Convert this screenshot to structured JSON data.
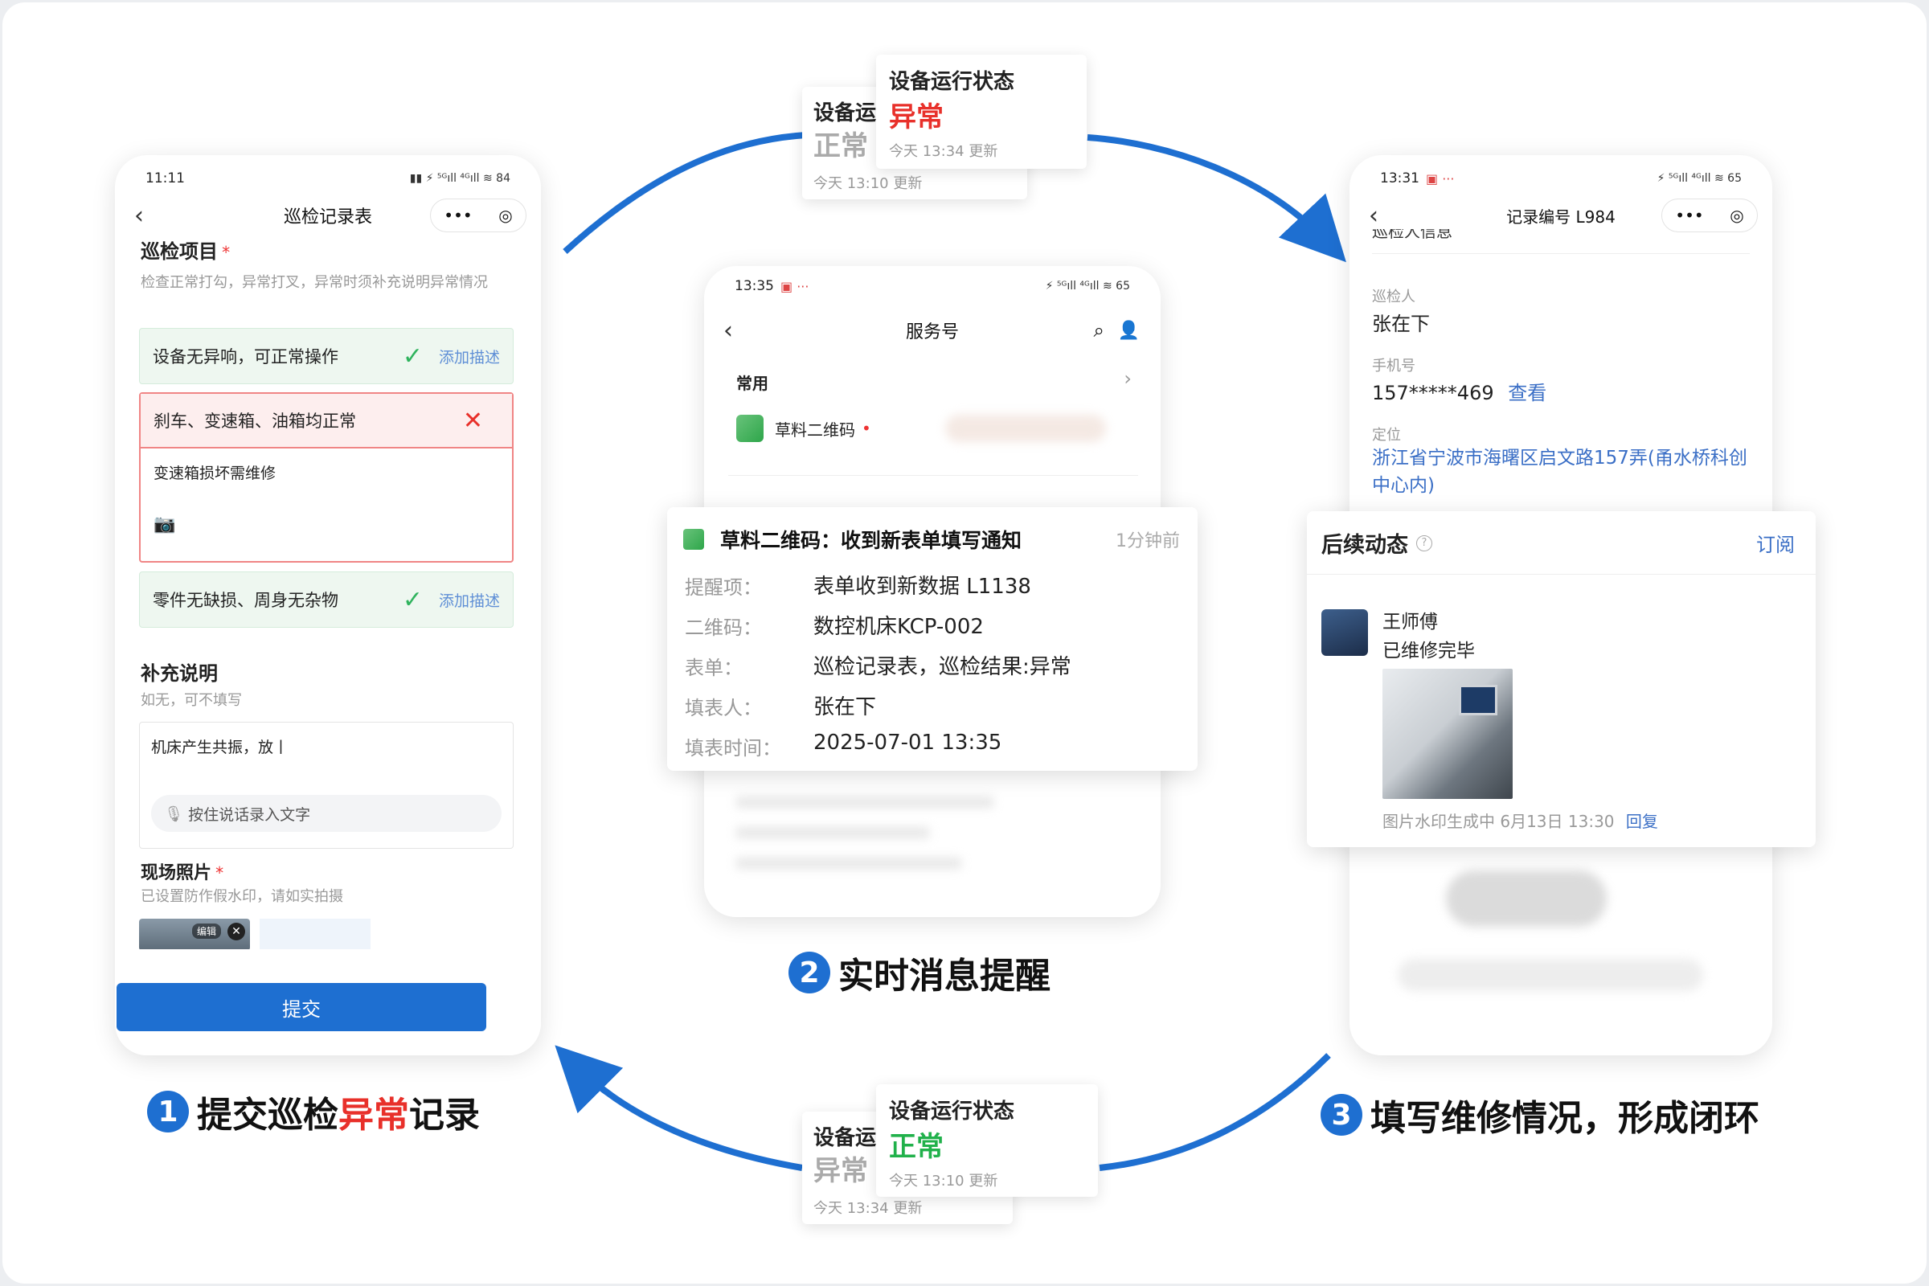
{
  "status_cards": {
    "top": {
      "back": {
        "title": "设备运",
        "value": "正常",
        "time": "今天 13:10 更新"
      },
      "front": {
        "title": "设备运行状态",
        "value": "异常",
        "time": "今天 13:34 更新"
      }
    },
    "bottom": {
      "back": {
        "title": "设备运",
        "value": "异常",
        "time": "今天 13:34 更新"
      },
      "front": {
        "title": "设备运行状态",
        "value": "正常",
        "time": "今天 13:10 更新"
      }
    }
  },
  "phone1": {
    "status_time": "11:11",
    "status_icons": "▮▮ ⚡ ⁵ᴳıll ⁴ᴳıll ≋ 84",
    "title": "巡检记录表",
    "section_title": "巡检项目",
    "required_mark": "*",
    "section_hint": "检查正常打勾，异常打叉，异常时须补充说明异常情况",
    "items": [
      {
        "label": "设备无异响，可正常操作",
        "action": "添加描述"
      },
      {
        "label": "刹车、变速箱、油箱均正常",
        "note": "变速箱损坏需维修"
      },
      {
        "label": "零件无缺损、周身无杂物",
        "action": "添加描述"
      }
    ],
    "supplement_title": "补充说明",
    "supplement_hint": "如无，可不填写",
    "supplement_text": "机床产生共振，放丨",
    "voice_hint": "按住说话录入文字",
    "photo_title": "现场照片",
    "photo_hint": "已设置防作假水印，请如实拍摄",
    "photo_edit": "编辑",
    "submit_label": "提交"
  },
  "phone2": {
    "status_time": "13:35",
    "status_icons": "⚡ ⁵ᴳıll ⁴ᴳıll ≋ 65",
    "title": "服务号",
    "section": "常用",
    "app_name": "草料二维码",
    "notification": {
      "title": "草料二维码：收到新表单填写通知",
      "time": "1分钟前",
      "rows": [
        {
          "label": "提醒项：",
          "value": "表单收到新数据 L1138"
        },
        {
          "label": "二维码：",
          "value": "数控机床KCP-002"
        },
        {
          "label": "表单：",
          "value": "巡检记录表，巡检结果:异常"
        },
        {
          "label": "填表人：",
          "value": "张在下"
        },
        {
          "label": "填表时间：",
          "value": "2025-07-01 13:35"
        }
      ]
    }
  },
  "phone3": {
    "status_time": "13:31",
    "status_icons": "⚡ ⁵ᴳıll ⁴ᴳıll ≋ 65",
    "title": "记录编号 L984",
    "cut_header": "巡检人信息",
    "inspector_label": "巡检人",
    "inspector_value": "张在下",
    "phone_label": "手机号",
    "phone_value": "157*****469",
    "phone_view": "查看",
    "location_label": "定位",
    "location_value": "浙江省宁波市海曙区启文路157弄(甬水桥科创中心内)",
    "followup": {
      "title": "后续动态",
      "subscribe": "订阅",
      "user": "王师傅",
      "message": "已维修完毕",
      "footer": "图片水印生成中  6月13日 13:30",
      "reply": "回复"
    }
  },
  "steps": {
    "step1": {
      "num": "1",
      "pre": "提交巡检",
      "highlight": "异常",
      "post": "记录"
    },
    "step2": {
      "num": "2",
      "text": "实时消息提醒"
    },
    "step3": {
      "num": "3",
      "text": "填写维修情况，形成闭环"
    }
  },
  "colors": {
    "accent": "#1e6fd1",
    "danger": "#e8302a",
    "ok": "#21b14b"
  }
}
